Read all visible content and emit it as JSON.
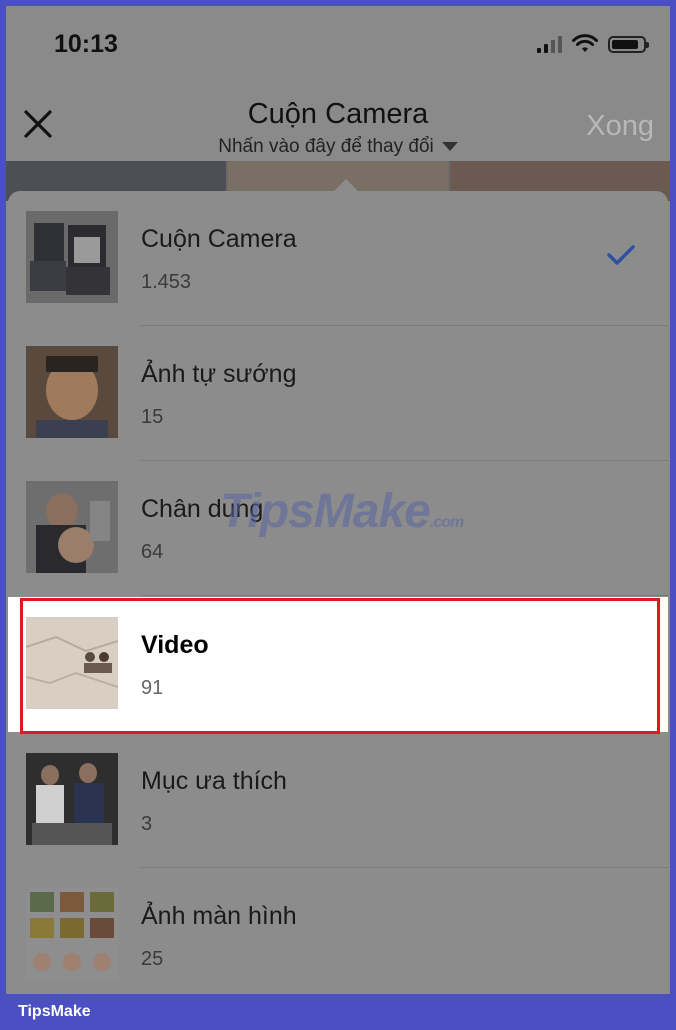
{
  "status_bar": {
    "time": "10:13"
  },
  "header": {
    "title": "Cuộn Camera",
    "subtitle": "Nhấn vào đây để thay đổi",
    "done_label": "Xong"
  },
  "albums": [
    {
      "name": "Cuộn Camera",
      "count": "1.453",
      "checked": true
    },
    {
      "name": "Ảnh tự sướng",
      "count": "15"
    },
    {
      "name": "Chân dung",
      "count": "64"
    },
    {
      "name": "Video",
      "count": "91",
      "highlighted": true
    },
    {
      "name": "Mục ưa thích",
      "count": "3"
    },
    {
      "name": "Ảnh màn hình",
      "count": "25"
    }
  ],
  "watermark": {
    "text": "TipsMake",
    "suffix": ".com"
  },
  "footer": {
    "brand": "TipsMake"
  },
  "colors": {
    "frame": "#4a4fc2",
    "check": "#2f4fa0",
    "highlight": "#e01919"
  }
}
